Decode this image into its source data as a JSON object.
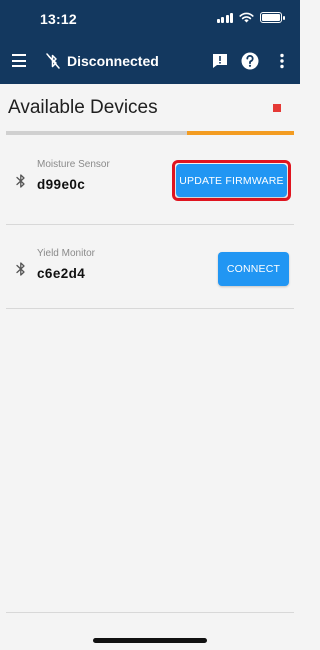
{
  "status_bar": {
    "time": "13:12"
  },
  "app_bar": {
    "title": "Disconnected",
    "icons": [
      "menu-icon",
      "bluetooth-disabled-icon",
      "feedback-icon",
      "help-icon",
      "more-vert-icon"
    ]
  },
  "header": {
    "title": "Available Devices",
    "status_indicator_color": "#e53935",
    "scan_progress": 0.37
  },
  "devices": [
    {
      "type": "Moisture Sensor",
      "id": "d99e0c",
      "action": "UPDATE FIRMWARE",
      "highlighted": true
    },
    {
      "type": "Yield Monitor",
      "id": "c6e2d4",
      "action": "CONNECT",
      "highlighted": false
    }
  ],
  "colors": {
    "app_bar": "#13385f",
    "button": "#2196f3",
    "progress_active": "#f39c21",
    "highlight_border": "#e0141f"
  }
}
